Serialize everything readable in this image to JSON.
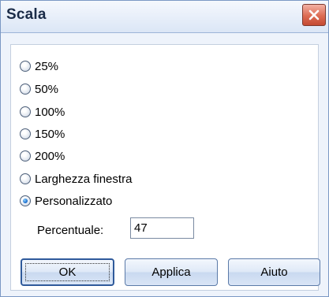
{
  "dialog": {
    "title": "Scala",
    "close_icon": "close-icon",
    "close_color": "#c44a33"
  },
  "options": [
    {
      "label": "25%",
      "checked": false
    },
    {
      "label": "50%",
      "checked": false
    },
    {
      "label": "100%",
      "checked": false
    },
    {
      "label": "150%",
      "checked": false
    },
    {
      "label": "200%",
      "checked": false
    },
    {
      "label": "Larghezza finestra",
      "checked": false
    },
    {
      "label": "Personalizzato",
      "checked": true
    }
  ],
  "percent": {
    "label": "Percentuale:",
    "value": "47"
  },
  "buttons": {
    "ok": "OK",
    "apply": "Applica",
    "help": "Aiuto"
  }
}
